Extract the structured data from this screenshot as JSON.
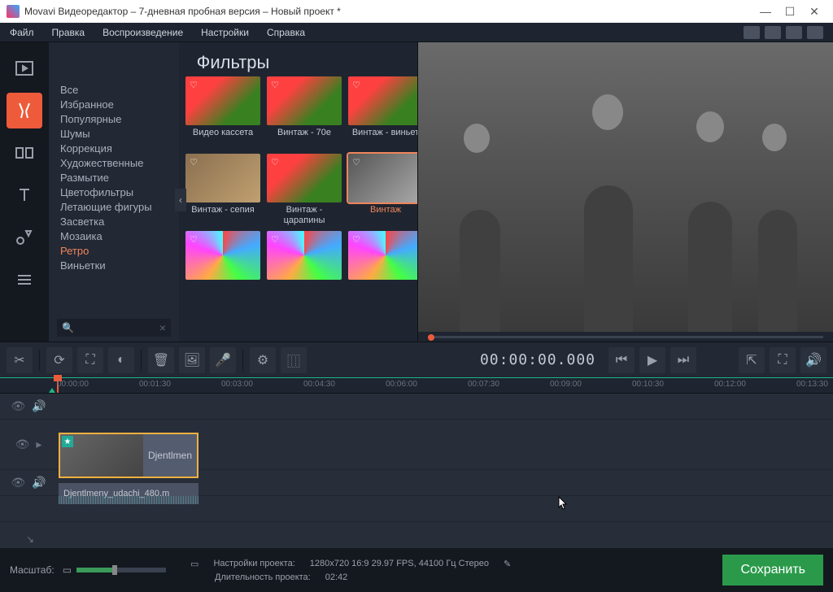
{
  "titlebar": {
    "title": "Movavi Видеоредактор – 7-дневная пробная версия – Новый проект *"
  },
  "menu": {
    "items": [
      "Файл",
      "Правка",
      "Воспроизведение",
      "Настройки",
      "Справка"
    ]
  },
  "panel": {
    "title": "Фильтры",
    "categories": [
      "Все",
      "Избранное",
      "Популярные",
      "Шумы",
      "Коррекция",
      "Художественные",
      "Размытие",
      "Цветофильтры",
      "Летающие фигуры",
      "Засветка",
      "Мозаика",
      "Ретро",
      "Виньетки"
    ],
    "active_category": "Ретро",
    "thumbs": [
      {
        "label": "Видео кассета",
        "cls": "flowers"
      },
      {
        "label": "Винтаж - 70е",
        "cls": "flowers"
      },
      {
        "label": "Винтаж - виньет",
        "cls": "flowers"
      },
      {
        "label": "Винтаж - сепия",
        "cls": "sepia"
      },
      {
        "label": "Винтаж - царапины",
        "cls": "flowers"
      },
      {
        "label": "Винтаж",
        "cls": "bw",
        "selected": true
      },
      {
        "label": "",
        "cls": "multi"
      },
      {
        "label": "",
        "cls": "multi"
      },
      {
        "label": "",
        "cls": "multi"
      }
    ]
  },
  "timecode": "00:00:00.000",
  "ruler": {
    "ticks": [
      "00:00:00",
      "00:01:30",
      "00:03:00",
      "00:04:30",
      "00:06:00",
      "00:07:30",
      "00:09:00",
      "00:10:30",
      "00:12:00",
      "00:13:30"
    ]
  },
  "clip": {
    "label": "Djentlmen"
  },
  "audio_clip": {
    "label": "Djentlmeny_udachi_480.m"
  },
  "footer": {
    "zoom_label": "Масштаб:",
    "proj_settings_label": "Настройки проекта:",
    "proj_settings_value": "1280x720 16:9 29.97 FPS, 44100 Гц Стерео",
    "proj_duration_label": "Длительность проекта:",
    "proj_duration_value": "02:42",
    "save": "Сохранить"
  }
}
